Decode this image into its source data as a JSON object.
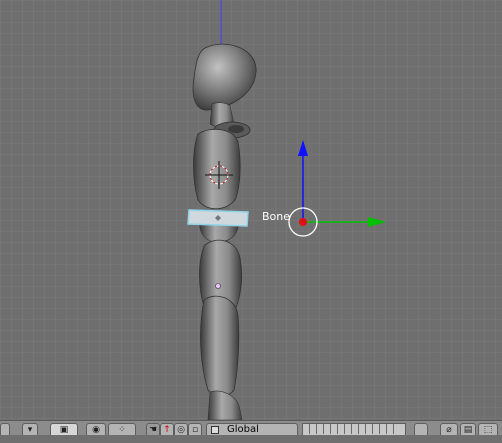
{
  "viewport": {
    "bone_label": "Bone"
  },
  "header": {
    "transform_orientation": "Global",
    "icons": {
      "view_menu": "view-menu-icon",
      "object_mode": "object-mode-icon",
      "pivot": "pivot-icon",
      "manipulator_hand": "manipulator-hand-icon",
      "manipulator_translate": "translate-icon",
      "manipulator_rotate": "rotate-icon",
      "snap": "snap-icon",
      "render": "render-icon"
    }
  },
  "colors": {
    "background": "#6f6f6f",
    "grid_line": "#7c7c7c",
    "axis_z": "#1010ff",
    "axis_y": "#00c000",
    "bone_selected": "#8fd3e8",
    "cursor_red": "#d01010"
  }
}
